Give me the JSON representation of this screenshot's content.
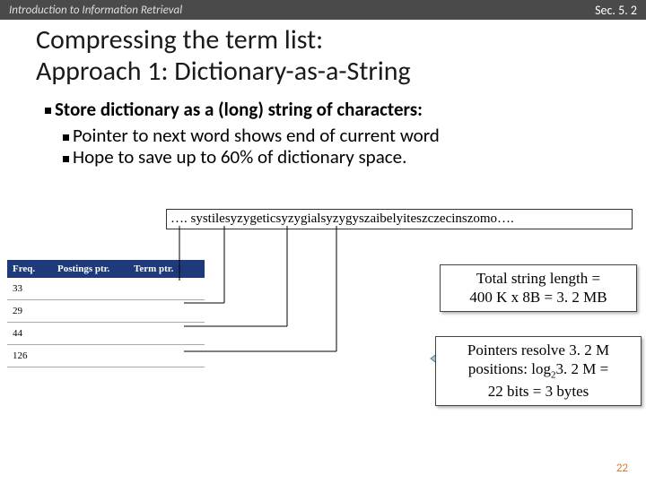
{
  "header": {
    "left": "Introduction to Information Retrieval",
    "right": "Sec. 5. 2"
  },
  "title_line1": "Compressing the term list:",
  "title_line2": "Approach 1: Dictionary-as-a-String",
  "bullets": {
    "main": "Store dictionary as a (long) string of characters:",
    "sub1": "Pointer to next word shows end of current word",
    "sub2": "Hope to save up to 60% of dictionary space."
  },
  "long_string": "…. systilesyzygeticsyzygialsyzygyszaibelyiteszczecinszomo…. ",
  "table": {
    "headers": [
      "Freq.",
      "Postings ptr.",
      "Term ptr."
    ],
    "rows": [
      [
        "33",
        "",
        ""
      ],
      [
        "29",
        "",
        ""
      ],
      [
        "44",
        "",
        ""
      ],
      [
        "126",
        "",
        ""
      ]
    ]
  },
  "box1": {
    "l1": "Total string length =",
    "l2": "400 K x 8B = 3. 2 MB"
  },
  "box2": {
    "l1": "Pointers resolve 3. 2 M",
    "l2_a": "positions: log",
    "l2_b": "2",
    "l2_c": "3. 2 M =",
    "l3": "22 bits = 3 bytes"
  },
  "page": "22"
}
